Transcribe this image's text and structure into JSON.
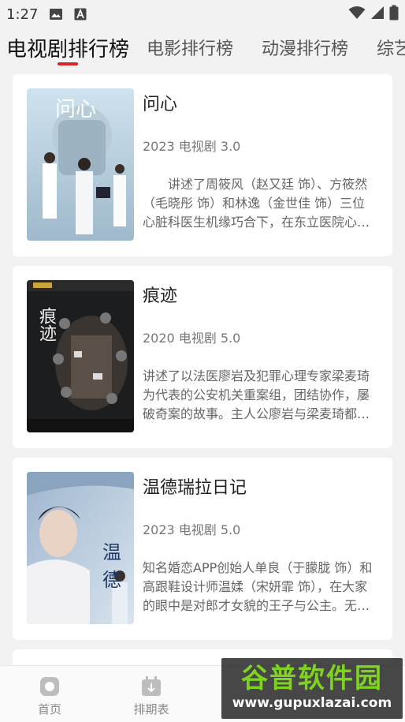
{
  "status_bar": {
    "time": "1:27",
    "icons": [
      "image-icon",
      "font-a-icon",
      "wifi-icon",
      "signal-icon",
      "battery-icon"
    ]
  },
  "tabs": [
    {
      "label": "电视剧排行榜",
      "active": true
    },
    {
      "label": "电影排行榜",
      "active": false
    },
    {
      "label": "动漫排行榜",
      "active": false
    },
    {
      "label": "综艺",
      "active": false
    }
  ],
  "items": [
    {
      "title": "问心",
      "meta": "2023 电视剧 3.0",
      "desc": "讲述了周筱风（赵又廷 饰）、方筱然（毛晓彤 饰）和林逸（金世佳 饰）三位心脏科医生机缘巧合下，在东立医院心脏中心相遇。三人因专业背景、职业理念不同而产生冲突……",
      "poster_text": "问心"
    },
    {
      "title": "痕迹",
      "meta": "2020 电视剧 5.0",
      "desc": "讲述了以法医廖岩及犯罪心理专家梁麦琦为代表的公安机关重案组，团结协作，屡破奇案的故事。主人公廖岩与梁麦琦都是国外学成归来的年轻刑事专家……",
      "poster_text": "痕迹"
    },
    {
      "title": "温德瑞拉日记",
      "meta": "2023 电视剧 5.0",
      "desc": "知名婚恋APP创始人单良（于朦胧 饰）和高跟鞋设计师温媃（宋妍霏 饰），在大家的眼中是对郎才女貌的王子与公主。无奈婚后温媃的名媛人设翻车，……",
      "poster_text": "温德"
    }
  ],
  "bottom_nav": [
    {
      "label": "首页",
      "icon": "home-icon"
    },
    {
      "label": "排期表",
      "icon": "calendar-icon"
    }
  ],
  "watermark": {
    "logo": "谷普软件园",
    "url": "www.gupuxlazai.com"
  },
  "colors": {
    "accent": "#d6262b",
    "watermark_green": "#7ed321"
  }
}
